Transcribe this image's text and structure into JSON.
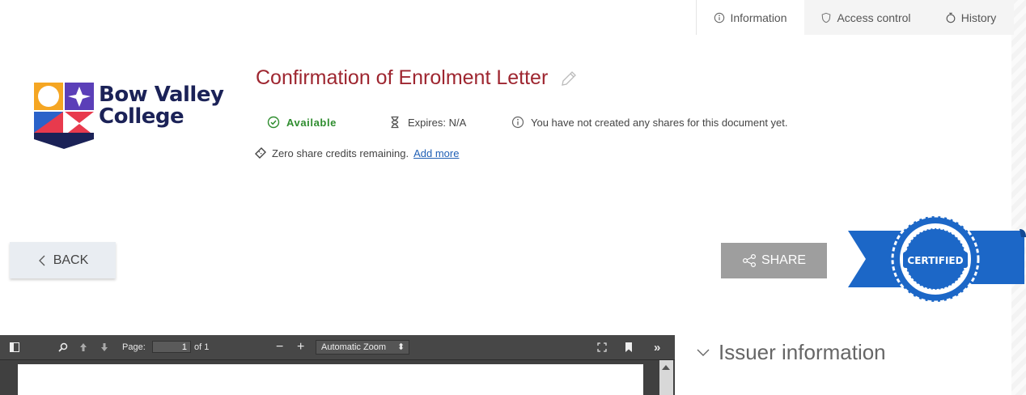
{
  "tabs": [
    {
      "label": "Information",
      "icon": "info-icon",
      "active": true
    },
    {
      "label": "Access control",
      "icon": "shield-icon",
      "active": false
    },
    {
      "label": "History",
      "icon": "stopwatch-icon",
      "active": false
    }
  ],
  "logo": {
    "line1": "Bow Valley",
    "line2": "College"
  },
  "document": {
    "title": "Confirmation of Enrolment Letter",
    "status": "Available",
    "expires": "Expires: N/A",
    "shares_note": "You have not created any shares for this document yet.",
    "credits_text": "Zero share credits remaining.",
    "credits_link": "Add more"
  },
  "buttons": {
    "back": "BACK",
    "share": "SHARE"
  },
  "badge": {
    "text": "CERTIFIED"
  },
  "pdf_viewer": {
    "page_label": "Page:",
    "page_value": "1",
    "page_total": "of 1",
    "zoom": "Automatic Zoom"
  },
  "section": {
    "issuer": "Issuer information"
  },
  "colors": {
    "title": "#9e2630",
    "available": "#2f8d2f",
    "link": "#1f5fb5",
    "ribbon": "#1c67c7",
    "logo_navy": "#1b2257"
  }
}
